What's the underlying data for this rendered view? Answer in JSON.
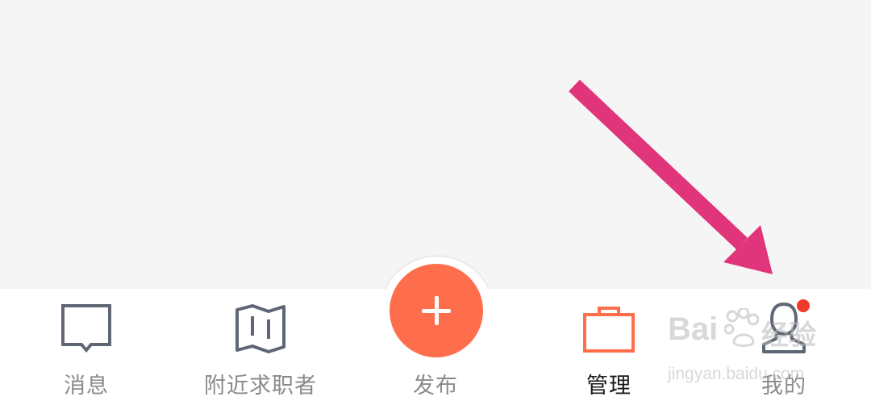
{
  "tabbar": {
    "tabs": [
      {
        "label": "消息",
        "icon": "message-icon"
      },
      {
        "label": "附近求职者",
        "icon": "map-icon"
      },
      {
        "label": "发布",
        "icon": "plus-icon"
      },
      {
        "label": "管理",
        "icon": "briefcase-icon",
        "active": true
      },
      {
        "label": "我的",
        "icon": "user-icon",
        "badge": true
      }
    ]
  },
  "colors": {
    "accent": "#ff6e4c",
    "icon_gray": "#5f6674",
    "label_gray": "#8a8a8a",
    "active_label": "#1a1a1a",
    "badge": "#f13a2b",
    "annotation_arrow": "#e0357a",
    "background": "#f5f5f5"
  },
  "watermark": {
    "brand": "Bai",
    "brand2": "经验",
    "domain": "jingyan.baidu.com"
  }
}
